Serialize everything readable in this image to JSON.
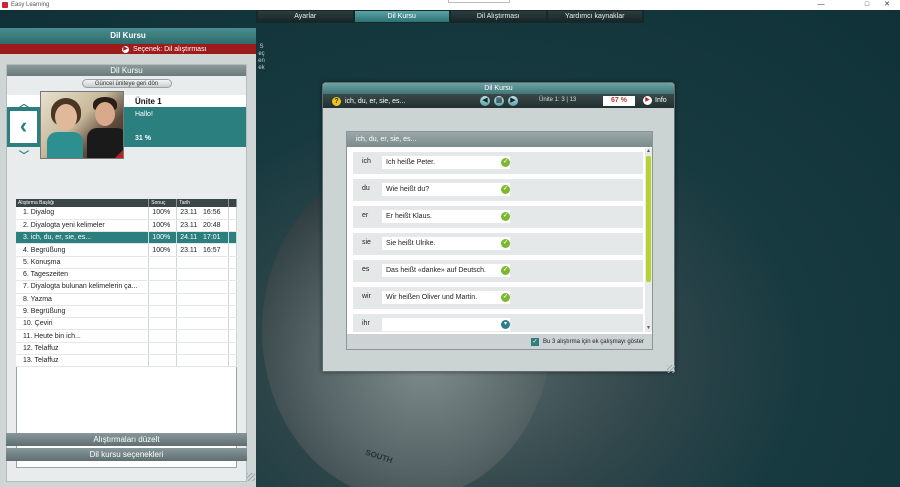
{
  "window": {
    "title": "Easy Learning",
    "minimize": "—",
    "maximize": "□",
    "close": "✕"
  },
  "top_menu": [
    {
      "label": "Ayarlar",
      "active": false
    },
    {
      "label": "Dil Kursu",
      "active": true
    },
    {
      "label": "Dil Alıştırması",
      "active": false
    },
    {
      "label": "Yardımcı kaynaklar",
      "active": false
    }
  ],
  "globe_label": "SOUTH",
  "left_panel": {
    "title": "Dil Kursu",
    "option_label": "Seçenek: Dil alıştırması",
    "side_tab": "Seçenek",
    "inner_title": "Dil Kursu",
    "back_button": "Güncel üniteye geri dön",
    "unit": {
      "name": "Ünite 1",
      "phrase": "Hallo!",
      "progress": "31 %"
    },
    "table": {
      "headers": [
        "Alıştırma Başlığı",
        "Sonuç",
        "Tarih",
        ""
      ],
      "rows": [
        {
          "title": "1. Diyalog",
          "result": "100%",
          "date": "23.11",
          "time": "16:56",
          "selected": false
        },
        {
          "title": "2. Diyalogta yeni kelimeler",
          "result": "100%",
          "date": "23.11",
          "time": "20:48",
          "selected": false
        },
        {
          "title": "3. ich, du, er, sie, es...",
          "result": "100%",
          "date": "24.11",
          "time": "17:01",
          "selected": true
        },
        {
          "title": "4. Begrüßung",
          "result": "100%",
          "date": "23.11",
          "time": "16:57",
          "selected": false
        },
        {
          "title": "5. Konuşma",
          "result": "",
          "date": "",
          "time": "",
          "selected": false
        },
        {
          "title": "6. Tageszeiten",
          "result": "",
          "date": "",
          "time": "",
          "selected": false
        },
        {
          "title": "7. Diyalogta bulunan kelimelerin ça...",
          "result": "",
          "date": "",
          "time": "",
          "selected": false
        },
        {
          "title": "8. Yazma",
          "result": "",
          "date": "",
          "time": "",
          "selected": false
        },
        {
          "title": "9. Begrüßung",
          "result": "",
          "date": "",
          "time": "",
          "selected": false
        },
        {
          "title": "10. Çeviri",
          "result": "",
          "date": "",
          "time": "",
          "selected": false
        },
        {
          "title": "11. Heute bin ich...",
          "result": "",
          "date": "",
          "time": "",
          "selected": false
        },
        {
          "title": "12. Telaffuz",
          "result": "",
          "date": "",
          "time": "",
          "selected": false
        },
        {
          "title": "13. Telaffuz",
          "result": "",
          "date": "",
          "time": "",
          "selected": false
        }
      ]
    },
    "edit_exercises": "Alıştırmaları düzelt",
    "course_options": "Dil kursu seçenekleri"
  },
  "dialog": {
    "title": "Dil Kursu",
    "toolbar_title": "ich, du, er, sie, es...",
    "unit_info": "Ünite 1:   3 | 13",
    "progress": "67 %",
    "info_label": "Info",
    "body_title": "ich, du, er, sie, es...",
    "rows": [
      {
        "pronoun": "ich",
        "answer": "Ich heiße Peter.",
        "status": "correct"
      },
      {
        "pronoun": "du",
        "answer": "Wie heißt du?",
        "status": "correct"
      },
      {
        "pronoun": "er",
        "answer": "Er heißt Klaus.",
        "status": "correct"
      },
      {
        "pronoun": "sie",
        "answer": "Sie heißt Ulrike.",
        "status": "correct"
      },
      {
        "pronoun": "es",
        "answer": "Das heißt «danke» auf Deutsch.",
        "status": "correct"
      },
      {
        "pronoun": "wir",
        "answer": "Wir heißen Oliver und Martin.",
        "status": "correct"
      },
      {
        "pronoun": "ihr",
        "answer": "",
        "status": "pending"
      }
    ],
    "footer_checkbox": "Bu 3 alıştırma için ek çalışmayı göster",
    "footer_checked": true
  },
  "colors": {
    "accent": "#2b7f7f",
    "alert": "#9e1b1b",
    "ok": "#7cb82f",
    "scroll": "#b5d22e"
  }
}
